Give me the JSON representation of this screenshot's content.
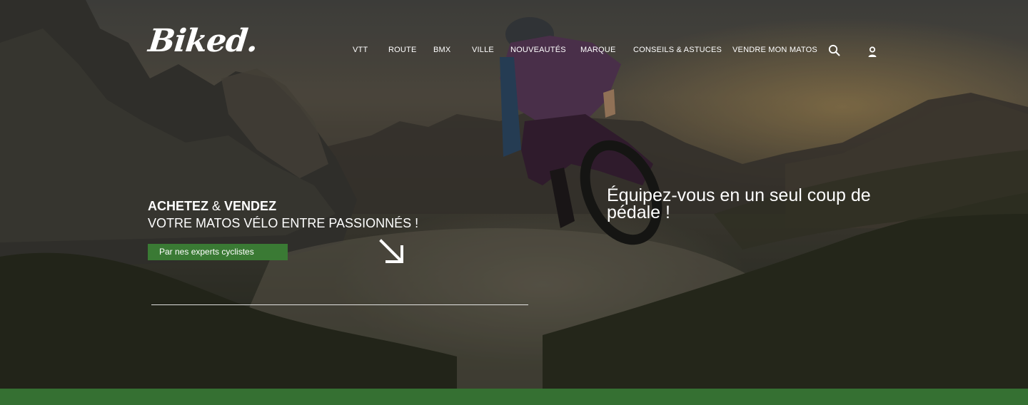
{
  "brand": {
    "logo_text": "Biked."
  },
  "nav": {
    "items": [
      {
        "label": "VTT"
      },
      {
        "label": "ROUTE"
      },
      {
        "label": "BMX"
      },
      {
        "label": "VILLE"
      },
      {
        "label": "NOUVEAUTÉS"
      },
      {
        "label": "MARQUE"
      },
      {
        "label": "CONSEILS & ASTUCES"
      },
      {
        "label": "VENDRE MON MATOS"
      }
    ],
    "search_icon": "search-icon",
    "account_icon": "user-icon"
  },
  "hero": {
    "tagline_buy": "ACHETEZ",
    "tagline_amp": "&",
    "tagline_sell": "VENDEZ",
    "tagline_line2": "VOTRE MATOS VÉLO ENTRE PASSIONNÉS !",
    "cta_label": "Par nes experts cyclistes",
    "arrow_icon": "arrow-down-right-icon",
    "headline": "Équipez-vous en un seul coup de pédale !"
  },
  "colors": {
    "accent_green": "#3a7a34",
    "footer_green": "#357032",
    "text": "#ffffff"
  }
}
